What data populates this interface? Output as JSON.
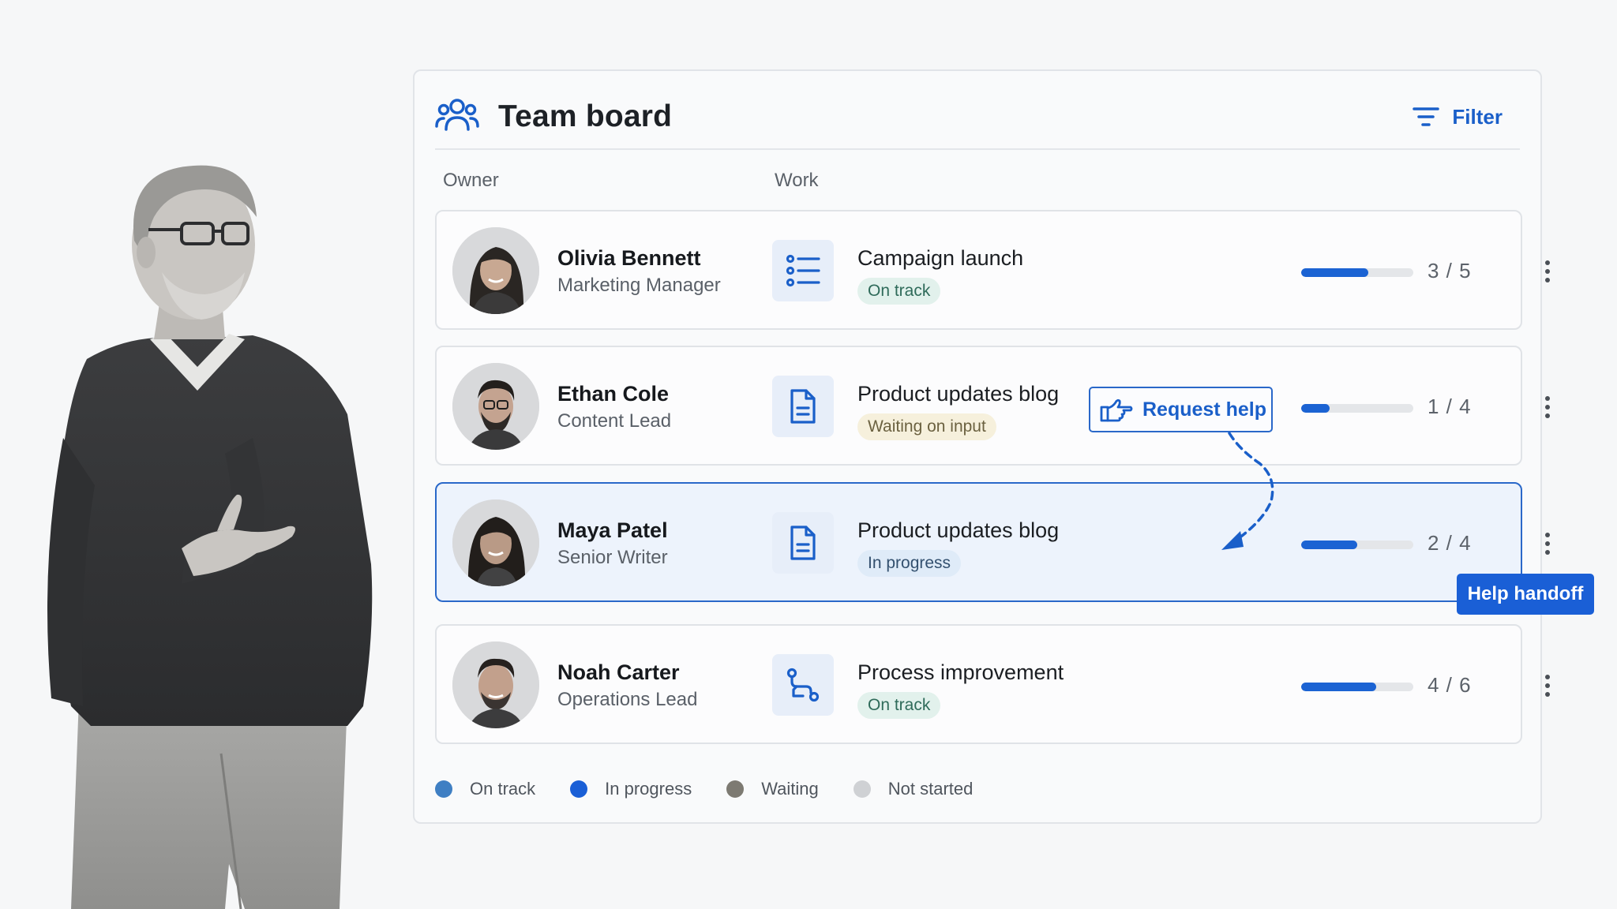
{
  "board": {
    "title": "Team board",
    "filter_label": "Filter",
    "columns": {
      "owner": "Owner",
      "work": "Work"
    }
  },
  "rows": [
    {
      "name": "Olivia Bennett",
      "role": "Marketing Manager",
      "work_icon": "checklist-icon",
      "work_title": "Campaign launch",
      "status": "On track",
      "progress_done": 3,
      "progress_total": 5,
      "progress_label": "3 / 5"
    },
    {
      "name": "Ethan Cole",
      "role": "Content Lead",
      "work_icon": "document-icon",
      "work_title": "Product updates blog",
      "status": "Waiting on input",
      "progress_done": 1,
      "progress_total": 4,
      "progress_label": "1 / 4",
      "action_label": "Request help",
      "action_icon": "pointing-hand-icon"
    },
    {
      "name": "Maya Patel",
      "role": "Senior Writer",
      "work_icon": "document-icon",
      "work_title": "Product updates blog",
      "status": "In progress",
      "progress_done": 2,
      "progress_total": 4,
      "progress_label": "2 / 4",
      "tag_label": "Help handoff"
    },
    {
      "name": "Noah Carter",
      "role": "Operations Lead",
      "work_icon": "workflow-icon",
      "work_title": "Process improvement",
      "status": "On track",
      "progress_done": 4,
      "progress_total": 6,
      "progress_label": "4 / 6"
    }
  ],
  "legend": [
    {
      "label": "On track",
      "color": "#3f7fc3"
    },
    {
      "label": "In progress",
      "color": "#1a5fd6"
    },
    {
      "label": "Waiting",
      "color": "#7d7a72"
    },
    {
      "label": "Not started",
      "color": "#cfd1d4"
    }
  ],
  "colors": {
    "accent": "#1a5fc9",
    "highlight_row": "#edf3fc",
    "progress": "#1b63d3"
  }
}
